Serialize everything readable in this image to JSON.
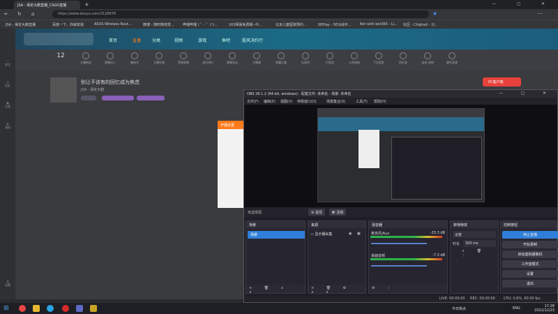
{
  "browser": {
    "tab_title": "JSA - 保定大鹏直播_CSGO直播",
    "new_tab": "+",
    "url": "https://www.douyu.com/3126878",
    "favorites": [
      "JSA - 保定大鹏直播",
      "百度一下，你就知道",
      "ASUS Wireless Rout...",
      "微博 - 随时随地发...",
      "哔哩哔哩 ( ゜- ゜)つ...",
      "163网易免费邮--中...",
      "北京儿童医院预约...",
      "SEPlay - 5E对战平...",
      "Bet with bet365 - Li...",
      "社区 - Chiphell - 分..."
    ],
    "window_controls": "— ◻ ✕"
  },
  "douyu": {
    "nav": [
      "首页",
      "直播",
      "分类",
      "视频",
      "游戏",
      "鱼吧",
      "股风决约行"
    ],
    "level": "12",
    "categories": [
      "主播粉丝",
      "直播达人",
      "集结号",
      "主播礼物",
      "荣誉勋章",
      "战力排行",
      "赛事风云",
      "主播课",
      "荣耀之路",
      "玩家列",
      "行家会",
      "斗鱼神秘",
      "7日签到",
      "回忆录",
      "连坐-送神",
      "蜂鸟竞速"
    ],
    "pc_download": "PC客户端",
    "room_title": "别让不该有的回忆成为焦虑",
    "room_meta": "JSA - 保定大鹏",
    "orange_header": "开播设置",
    "side_icons": [
      "关注",
      "历史",
      "分类",
      "游戏",
      "设置"
    ]
  },
  "obs": {
    "title": "OBS 28.1.2 (64-bit, windows) - 配置文件: 未命名 - 场景: 未命名",
    "window_controls": "— ◻ ✕",
    "menu": [
      "文件(F)",
      "编辑(E)",
      "视图(V)",
      "停靠窗口(D)",
      "场景集合(S)",
      "工具(T)",
      "帮助(H)"
    ],
    "no_scene": "未选择源",
    "properties_btn": "⚙ 属性",
    "filters_btn": "◩ 滤镜",
    "docks": {
      "scenes": {
        "title": "场景",
        "items": [
          "场景"
        ]
      },
      "sources": {
        "title": "来源",
        "items": [
          "显示器采集"
        ]
      },
      "mixer": {
        "title": "混音器",
        "tracks": [
          {
            "name": "麦克风/Aux",
            "db": "-33.3 dB"
          },
          {
            "name": "桌面音频",
            "db": "-7.3 dB"
          }
        ]
      },
      "transitions": {
        "title": "转场特效",
        "type": "淡变",
        "duration_label": "时长",
        "duration": "300 ms"
      },
      "controls": {
        "title": "控制按钮",
        "buttons": [
          "停止直播",
          "开始录制",
          "启动虚拟摄像机",
          "工作室模式",
          "设置",
          "退出"
        ]
      }
    },
    "status": {
      "live": "LIVE: 00:00:00",
      "rec": "REC: 00:00:00",
      "cpu": "CPU: 0.6%, 60.00 fps"
    }
  },
  "taskbar": {
    "weather": "今日热点",
    "lang": "ENG",
    "time": "17:28",
    "date": "2022/12/23"
  }
}
